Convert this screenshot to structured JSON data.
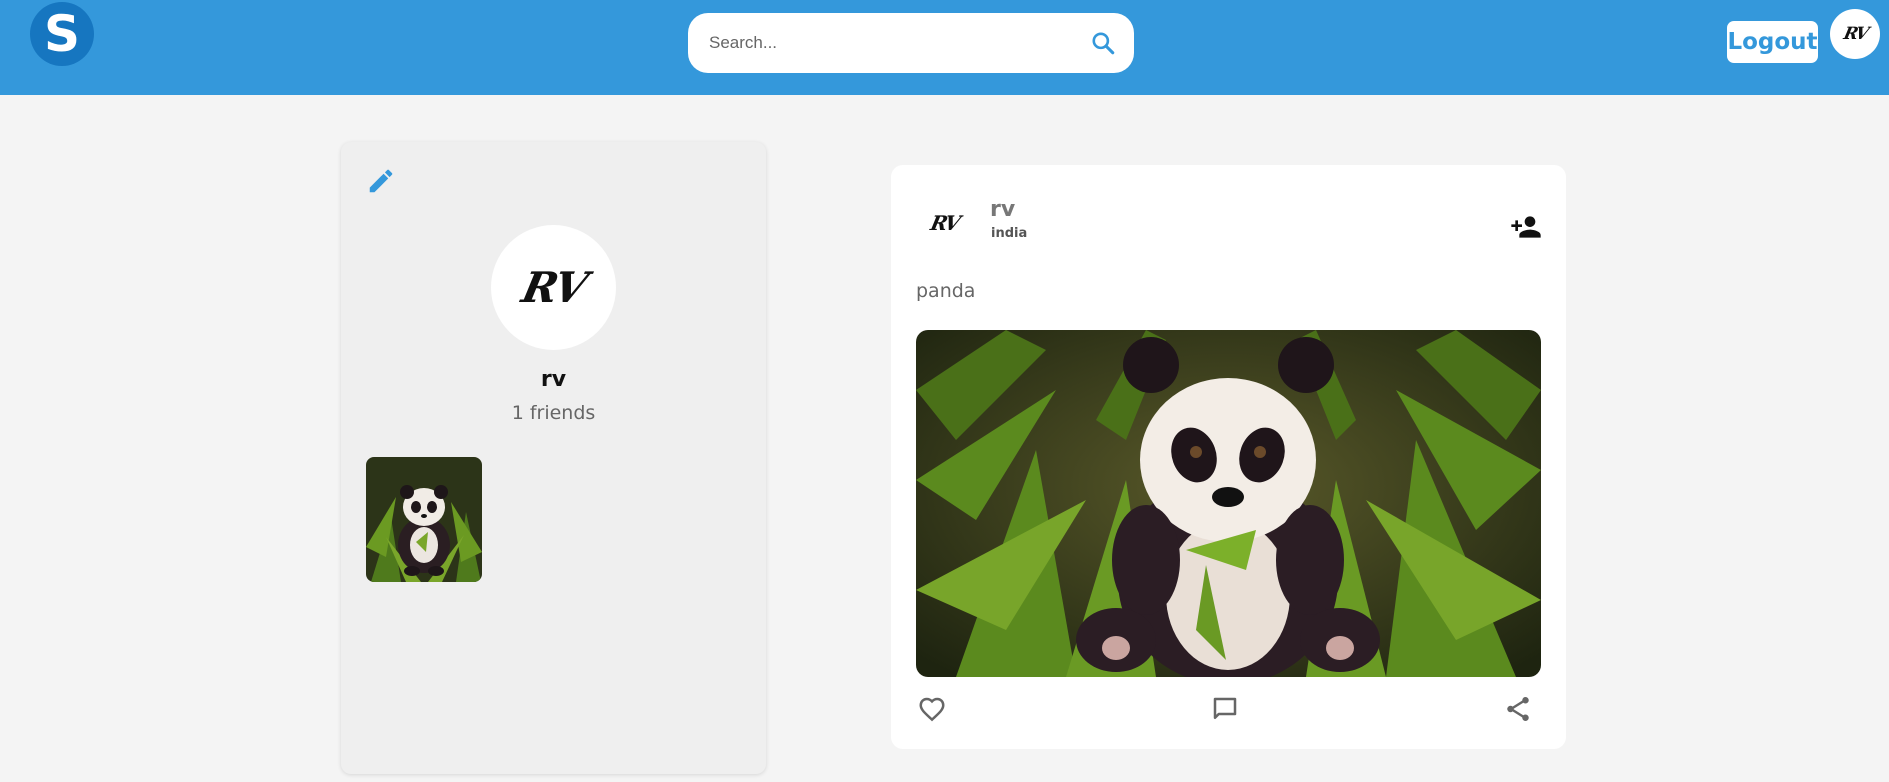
{
  "header": {
    "logo_letter": "S",
    "search_placeholder": "Search...",
    "logout_label": "Logout",
    "avatar_initials": "RV",
    "brand_color": "#3498db"
  },
  "profile": {
    "avatar_initials": "RV",
    "name": "rv",
    "friends_text": "1 friends",
    "edit_icon": "pencil-icon",
    "thumbnail": "panda-thumbnail"
  },
  "post": {
    "avatar_initials": "RV",
    "author": "rv",
    "location": "india",
    "caption": "panda",
    "image": "panda-image",
    "icons": {
      "add_friend": "person-add-icon",
      "like": "heart-outline-icon",
      "comment": "comment-icon",
      "share": "share-icon"
    }
  }
}
